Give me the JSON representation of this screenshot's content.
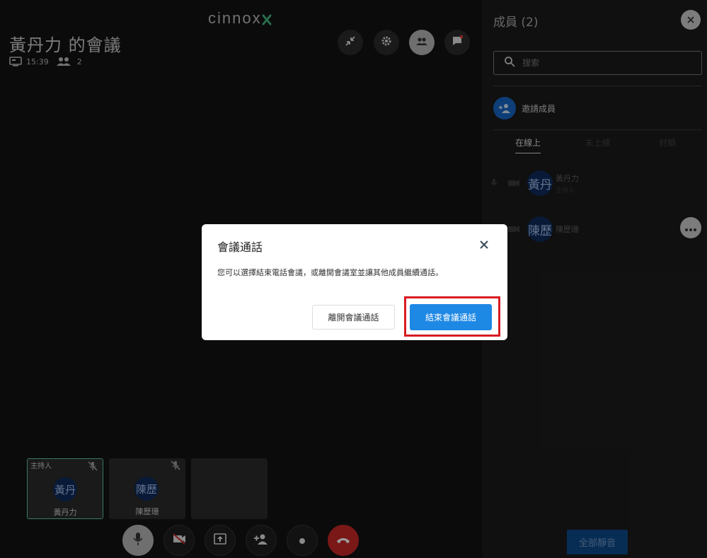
{
  "app": {
    "logo_text": "cinnox"
  },
  "meeting": {
    "title": "黃丹力 的會議",
    "duration": "15:39",
    "participant_count": "2"
  },
  "top_buttons": [
    "minimize-icon",
    "settings-icon",
    "participants-icon",
    "chat-icon"
  ],
  "tiles": [
    {
      "role": "主持人",
      "avatar": "黃丹",
      "name": "黃丹力"
    },
    {
      "role": "",
      "avatar": "陳歷",
      "name": "陳歷珊"
    }
  ],
  "panel": {
    "title": "成員 (2)",
    "search_placeholder": "搜索",
    "invite_label": "邀請成員",
    "tabs": [
      "在線上",
      "未上線",
      "封鎖"
    ],
    "members": [
      {
        "avatar": "黃丹",
        "name": "黃丹力",
        "role": "主持人"
      },
      {
        "avatar": "陳歷",
        "name": "陳歷珊",
        "role": ""
      }
    ],
    "mute_all_label": "全部靜音"
  },
  "modal": {
    "title": "會議通話",
    "message": "您可以選擇結束電話會議，或離開會議室並讓其他成員繼續通話。",
    "leave_label": "離開會議通話",
    "end_label": "結束會議通話"
  },
  "colors": {
    "accent": "#1e88e5",
    "end_call": "#c62828",
    "highlight": "#d71c22"
  }
}
